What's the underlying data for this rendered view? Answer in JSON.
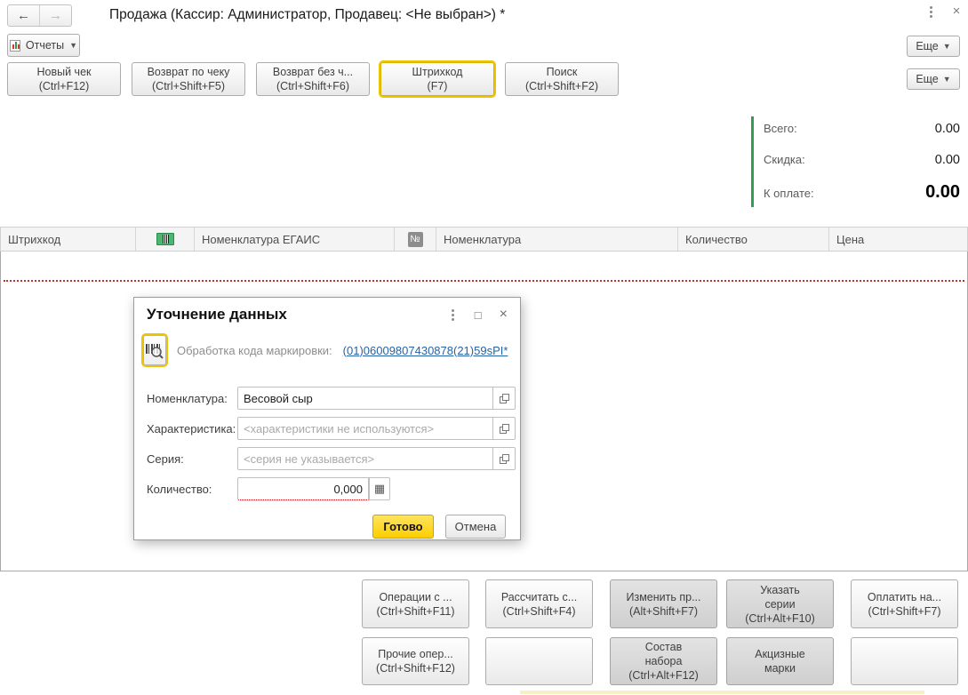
{
  "window": {
    "title": "Продажа (Кассир: Администратор, Продавец: <Не выбран>) *"
  },
  "icons": {
    "back": "←",
    "forward": "→",
    "dropdown": "▼",
    "close": "×",
    "maximize": "□",
    "calculator": "▦"
  },
  "toolbar": {
    "reports_label": "Отчеты",
    "more_label": "Еще"
  },
  "commands": [
    {
      "label": "Новый чек",
      "shortcut": "(Ctrl+F12)"
    },
    {
      "label": "Возврат по чеку",
      "shortcut": "(Ctrl+Shift+F5)"
    },
    {
      "label": "Возврат без ч...",
      "shortcut": "(Ctrl+Shift+F6)"
    },
    {
      "label": "Штрихкод",
      "shortcut": "(F7)",
      "focused": true
    },
    {
      "label": "Поиск",
      "shortcut": "(Ctrl+Shift+F2)"
    }
  ],
  "totals": {
    "rows": [
      {
        "label": "Всего:",
        "value": "0.00"
      },
      {
        "label": "Скидка:",
        "value": "0.00"
      },
      {
        "label": "К оплате:",
        "value": "0.00"
      }
    ]
  },
  "table": {
    "columns": {
      "barcode": "Штрихкод",
      "egais": "Номенклатура ЕГАИС",
      "num_badge": "№",
      "nomenclature": "Номенклатура",
      "quantity": "Количество",
      "price": "Цена"
    }
  },
  "dialog": {
    "title": "Уточнение данных",
    "marking_label": "Обработка кода маркировки:",
    "marking_link": "(01)06009807430878(21)59sPI*",
    "fields": [
      {
        "label": "Номенклатура:",
        "value": "Весовой сыр"
      },
      {
        "label": "Характеристика:",
        "placeholder": "<характеристики не используются>"
      },
      {
        "label": "Серия:",
        "placeholder": "<серия не указывается>"
      },
      {
        "label": "Количество:",
        "value": "0,000"
      }
    ],
    "done_label": "Готово",
    "cancel_label": "Отмена"
  },
  "actions": {
    "row1": [
      {
        "label": "Операции с ...",
        "shortcut": "(Ctrl+Shift+F11)"
      },
      {
        "label": "Рассчитать с...",
        "shortcut": "(Ctrl+Shift+F4)"
      },
      {
        "label": "Изменить пр...",
        "shortcut": "(Alt+Shift+F7)",
        "pressed": true
      },
      {
        "label": "Указать\nсерии",
        "shortcut": "(Ctrl+Alt+F10)",
        "pressed": true
      },
      {
        "label": "Оплатить на...",
        "shortcut": "(Ctrl+Shift+F7)"
      }
    ],
    "row2": [
      {
        "label": "Прочие опер...",
        "shortcut": "(Ctrl+Shift+F12)"
      },
      {
        "label": "",
        "shortcut": ""
      },
      {
        "label": "Состав\nнабора",
        "shortcut": "(Ctrl+Alt+F12)",
        "pressed": true
      },
      {
        "label": "Акцизные\nмарки",
        "shortcut": "",
        "pressed": true
      },
      {
        "label": "",
        "shortcut": ""
      }
    ]
  },
  "colors": {
    "focus_yellow": "#eec300",
    "default_button_yellow": "#ffd600",
    "link_blue": "#2563a8",
    "totals_green": "#2e9e52",
    "required_red": "#c00000"
  }
}
